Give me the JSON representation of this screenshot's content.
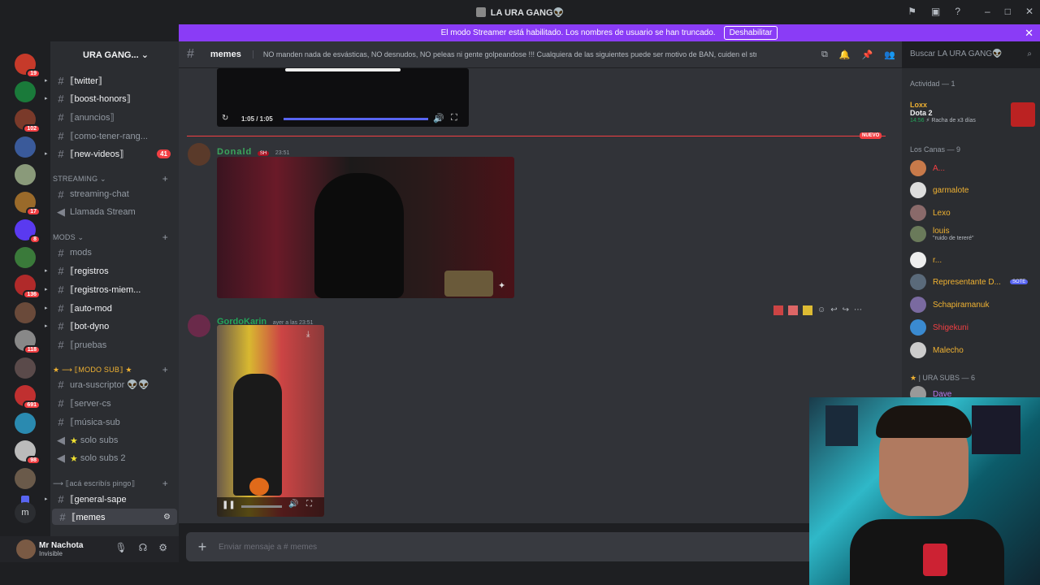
{
  "window": {
    "title": "LA URA GANG👽"
  },
  "banner": {
    "text": "El modo Streamer está habilitado. Los nombres de usuario se han truncado.",
    "button": "Deshabilitar"
  },
  "colors": {
    "accent": "#5865f2",
    "banner": "#8a3cf6",
    "danger": "#f23f43",
    "online": "#23a55a"
  },
  "server": {
    "name": "URA GANG..."
  },
  "rail": {
    "badges": [
      "19",
      "102",
      "17",
      "8",
      "136",
      "118",
      "691",
      "98"
    ]
  },
  "channels": [
    {
      "label": "⟦twitter⟧",
      "bright": true
    },
    {
      "label": "⟦boost-honors⟧",
      "bright": true
    },
    {
      "label": "⟦anuncios⟧",
      "bright": false
    },
    {
      "label": "⟦como-tener-rang...",
      "bright": false
    },
    {
      "label": "⟦new-videos⟧",
      "bright": true,
      "count": "41"
    }
  ],
  "categories": {
    "streaming": "STREAMING",
    "mods": "mods",
    "modosub": "⟦MODO SUB⟧",
    "aca": "⟦acá escribís pingo⟧"
  },
  "streaming_channels": [
    "streaming-chat",
    "Llamada Stream"
  ],
  "mods_channels": [
    "mods",
    "⟦registros",
    "⟦registros-miem...",
    "⟦auto-mod",
    "⟦bot-dyno",
    "⟦pruebas"
  ],
  "sub_channels": [
    "ura-suscriptor 👽👽",
    "⟦server-cs",
    "⟦música-sub",
    "solo subs",
    "solo subs 2"
  ],
  "aca_channels": [
    "⟦general-sape",
    "⟦memes"
  ],
  "user": {
    "name": "Mr Nachota",
    "status": "Invisible"
  },
  "chat_header": {
    "channel": "memes",
    "topic": "NO manden nada de esvásticas, NO desnudos, NO peleas ni gente golpeandose !!! Cualquiera de las siguientes puede ser motivo de BAN, cuiden el stream!"
  },
  "search": {
    "placeholder": "Buscar LA URA GANG👽"
  },
  "video1": {
    "time": "1:05 / 1:05",
    "progress": 1.0
  },
  "new_marker": "NUEVO",
  "messages": [
    {
      "author": "Donald",
      "badge": "SH",
      "time": "23:51",
      "color": "#3ba55c"
    },
    {
      "author": "GordoKarin",
      "time": "ayer a las 23:51",
      "color": "#23a55a"
    }
  ],
  "composer": {
    "placeholder": "Enviar mensaje a #  memes"
  },
  "members": {
    "activity_header": "Actividad — 1",
    "activity": {
      "name": "Loxx",
      "game": "Dota 2",
      "time": "14:56",
      "detail": "Racha de x3 días"
    },
    "group1_header": "Los Canas — 9",
    "group1": [
      {
        "name": "A...",
        "color": "#f23f43",
        "sub": ""
      },
      {
        "name": "garmalote",
        "color": "#f0b232",
        "sub": ""
      },
      {
        "name": "Lexo",
        "color": "#f0b232",
        "sub": ""
      },
      {
        "name": "louis",
        "color": "#f0b232",
        "sub": "\"ruido de tereré\""
      },
      {
        "name": "r...",
        "color": "#f0b232",
        "sub": ""
      },
      {
        "name": "Representante D...",
        "color": "#f0b232",
        "sub": "",
        "tag": "SOTE"
      },
      {
        "name": "Schapiramanuk",
        "color": "#f0b232",
        "sub": ""
      },
      {
        "name": "Shigekuni",
        "color": "#f23f43",
        "sub": ""
      },
      {
        "name": "Malecho",
        "color": "#f0b232",
        "sub": ""
      }
    ],
    "group2_header": "| URA SUBS — 6",
    "group2": [
      {
        "name": "Dave",
        "color": "#b57bee"
      }
    ]
  }
}
